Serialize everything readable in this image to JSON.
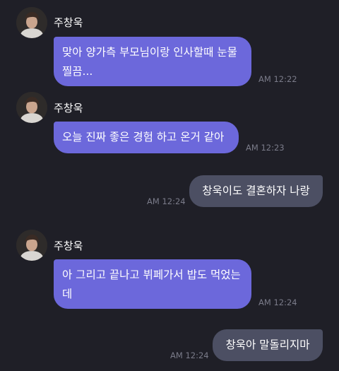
{
  "contact": {
    "name": "주창욱"
  },
  "colors": {
    "background": "#1f1f27",
    "incoming_bubble": "#6c68db",
    "outgoing_bubble": "#4c4f63",
    "timestamp": "#7a7b89"
  },
  "messages": [
    {
      "direction": "incoming",
      "sender": "주창욱",
      "text": "맞아 양가측 부모님이랑 인사할때 눈물 찔끔...",
      "time": "AM 12:22",
      "show_avatar": true
    },
    {
      "direction": "incoming",
      "sender": "주창욱",
      "text": "오늘 진짜 좋은 경험 하고 온거 같아",
      "time": "AM 12:23",
      "show_avatar": true
    },
    {
      "direction": "outgoing",
      "text": "창욱이도 결혼하자 나랑",
      "time": "AM 12:24"
    },
    {
      "direction": "incoming",
      "sender": "주창욱",
      "text": "아 그리고 끝나고 뷔페가서 밥도 먹었는데",
      "time": "AM 12:24",
      "show_avatar": true
    },
    {
      "direction": "outgoing",
      "text": "창욱아 말돌리지마",
      "time": "AM 12:24"
    }
  ]
}
